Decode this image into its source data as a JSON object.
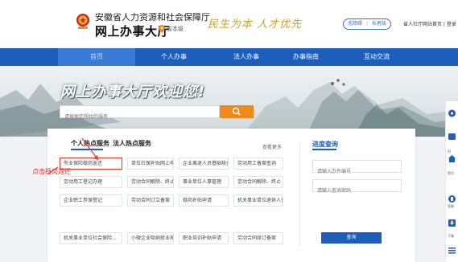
{
  "header": {
    "org_name": "安徽省人力资源和社会保障厅",
    "hall_title": "网上办事大厅",
    "location": "省本级",
    "slogan": "民生为本 人才优先",
    "access_modes": [
      "无障碍",
      "长者版"
    ],
    "top_links": "省人社厅网站首页 | 登录"
  },
  "nav": {
    "items": [
      "首页",
      "个人办事",
      "法人办事",
      "办事指南",
      "互动交流"
    ],
    "active": "首页"
  },
  "hero": {
    "title": "网上办事大厅欢迎您!",
    "search_placeholder": "请搜索您想找的服务"
  },
  "services": {
    "tabs": [
      "个人热点服务",
      "法人热点服务"
    ],
    "active_tab": "个人热点服务",
    "more_label": "查看更多",
    "items": [
      "失业保险稳岗返还",
      "单位社保补贴网上申报",
      "企业离退人员基础核查",
      "劳动用工备案查询",
      "劳动用工登记办理",
      "劳动合同解除、终止",
      "事业单位人事管理",
      "劳动合同解除、终止",
      "企业职工参保登记",
      "劳动合同订立备案",
      "稳岗补贴申请",
      "机关事业单位退休人员...",
      "机关事业单位社会保险...",
      "小微企业吸纳就业补贴...",
      "职业培训补贴申请",
      "劳动合同续订备案"
    ],
    "selected_item": "失业保险稳岗返还"
  },
  "progress": {
    "title": "进度查询",
    "fields": [
      "请输入办件编号",
      "请输入查询密码"
    ],
    "query_label": "查询"
  },
  "annotation": {
    "text": "点击稳岗返还",
    "color": "#e8362c"
  },
  "float_bar": {
    "labels": [
      "",
      "AI",
      "首页",
      "智能",
      "下载"
    ]
  },
  "colors": {
    "nav_blue": "#1d5dbb",
    "search_orange": "#f08a1a",
    "annotation_red": "#e8362c",
    "slogan_gold": "#c9a227"
  }
}
